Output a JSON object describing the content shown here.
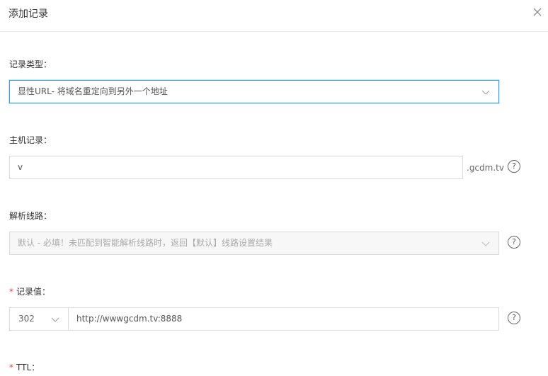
{
  "dialog": {
    "title": "添加记录"
  },
  "record_type": {
    "label": "记录类型：",
    "value": "显性URL- 将域名重定向到另外一个地址"
  },
  "host": {
    "label": "主机记录：",
    "value": "v",
    "suffix": ".gcdm.tv"
  },
  "line": {
    "label": "解析线路：",
    "value": "默认 - 必填！未匹配到智能解析线路时，返回【默认】线路设置结果"
  },
  "record_value": {
    "required_mark": "*",
    "label": "记录值：",
    "redirect_code": "302",
    "value": "http://wwwgcdm.tv:8888"
  },
  "ttl": {
    "required_mark": "*",
    "label": "TTL："
  },
  "help_glyph": "?",
  "icons": {
    "close": "close-icon",
    "chevron": "chevron-down-icon",
    "help": "question-circle-icon"
  }
}
